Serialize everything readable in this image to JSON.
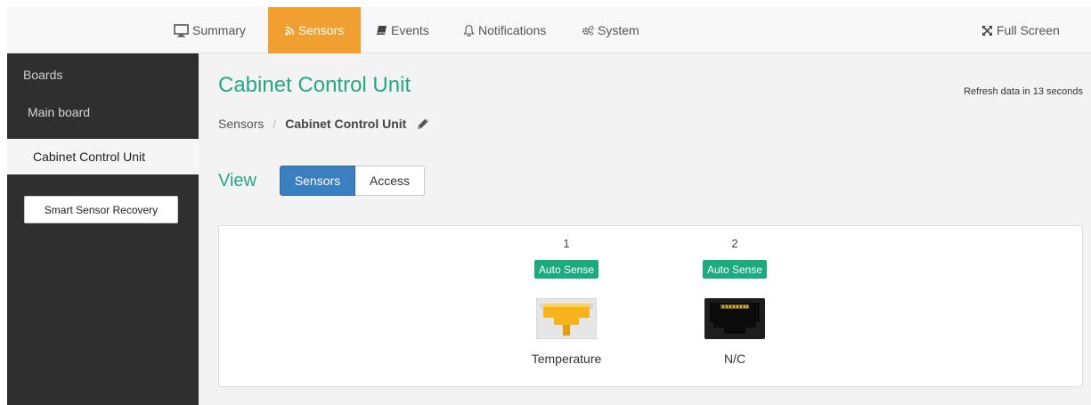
{
  "nav": {
    "items": [
      {
        "label": "Summary",
        "icon": "monitor-icon"
      },
      {
        "label": "Sensors",
        "icon": "rss-icon",
        "active": true
      },
      {
        "label": "Events",
        "icon": "book-icon"
      },
      {
        "label": "Notifications",
        "icon": "bell-icon"
      },
      {
        "label": "System",
        "icon": "cogs-icon"
      }
    ],
    "fullscreen": {
      "label": "Full Screen",
      "icon": "expand-icon"
    }
  },
  "sidebar": {
    "heading": "Boards",
    "items": [
      {
        "label": "Main board"
      },
      {
        "label": "Cabinet Control Unit",
        "active": true
      }
    ],
    "recovery_button": "Smart Sensor Recovery"
  },
  "main": {
    "title": "Cabinet Control Unit",
    "refresh_text": "Refresh data in 13 seconds",
    "breadcrumb": {
      "root": "Sensors",
      "separator": "/",
      "current": "Cabinet Control Unit"
    },
    "view_label": "View",
    "view_buttons": [
      {
        "label": "Sensors",
        "selected": true
      },
      {
        "label": "Access",
        "selected": false
      }
    ],
    "ports": [
      {
        "number": "1",
        "badge": "Auto Sense",
        "label": "Temperature",
        "icon": "rj45-yellow-icon"
      },
      {
        "number": "2",
        "badge": "Auto Sense",
        "label": "N/C",
        "icon": "rj45-black-icon"
      }
    ]
  },
  "colors": {
    "accent_green": "#26a689",
    "badge_green": "#1bab7e",
    "nav_active": "#f0a030",
    "button_blue": "#3c7fc0",
    "sidebar_bg": "#2f2f2f"
  }
}
